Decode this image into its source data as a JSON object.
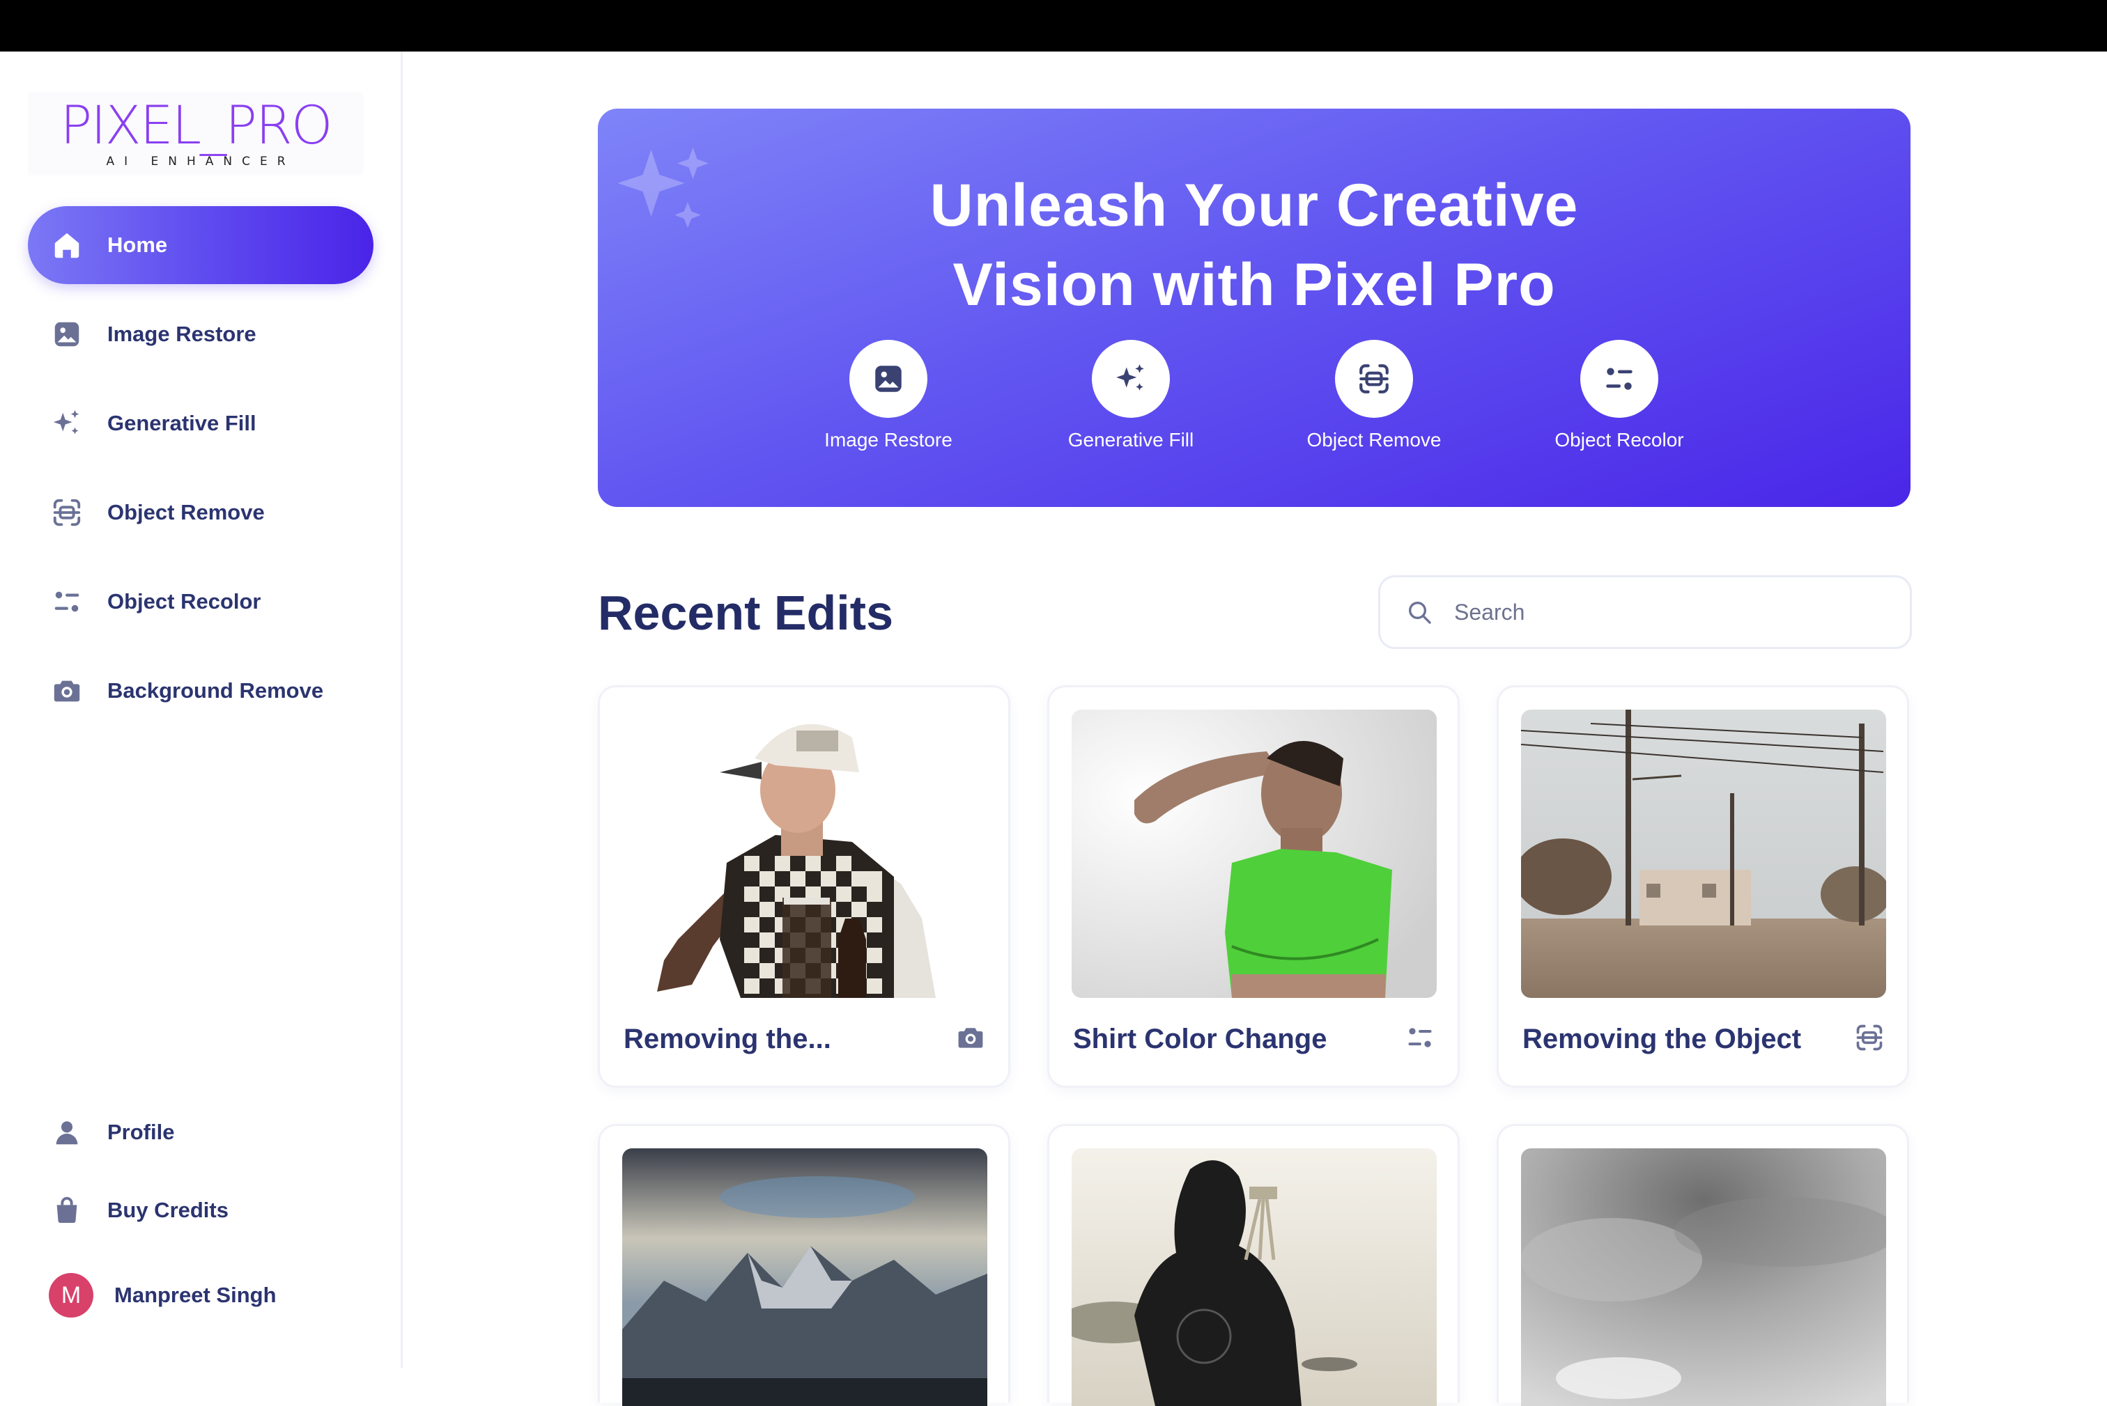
{
  "logo": {
    "main": "PIXEL_PRO",
    "sub": "AI ENHANCER"
  },
  "sidebar": {
    "items": [
      {
        "label": "Home",
        "icon": "home-icon",
        "active": true
      },
      {
        "label": "Image Restore",
        "icon": "image-icon"
      },
      {
        "label": "Generative Fill",
        "icon": "sparkles-icon"
      },
      {
        "label": "Object Remove",
        "icon": "scan-icon"
      },
      {
        "label": "Object Recolor",
        "icon": "recolor-icon"
      },
      {
        "label": "Background Remove",
        "icon": "camera-icon"
      }
    ],
    "bottom": [
      {
        "label": "Profile",
        "icon": "user-icon"
      },
      {
        "label": "Buy Credits",
        "icon": "bag-icon"
      }
    ],
    "user": {
      "initial": "M",
      "name": "Manpreet Singh"
    }
  },
  "hero": {
    "title_line1": "Unleash Your Creative",
    "title_line2": "Vision with Pixel Pro",
    "tools": [
      {
        "label": "Image Restore",
        "icon": "image-icon"
      },
      {
        "label": "Generative Fill",
        "icon": "sparkles-icon"
      },
      {
        "label": "Object Remove",
        "icon": "scan-icon"
      },
      {
        "label": "Object Recolor",
        "icon": "recolor-icon"
      }
    ]
  },
  "recent": {
    "title": "Recent Edits",
    "search_placeholder": "Search",
    "cards": [
      {
        "title": "Removing the...",
        "icon": "camera-icon"
      },
      {
        "title": "Shirt Color Change",
        "icon": "recolor-icon"
      },
      {
        "title": "Removing the Object",
        "icon": "scan-icon"
      },
      {
        "title": "",
        "icon": ""
      },
      {
        "title": "",
        "icon": ""
      },
      {
        "title": "",
        "icon": ""
      }
    ]
  },
  "colors": {
    "accent": "#5b45ee",
    "text": "#2b3470",
    "avatar": "#d8416a",
    "logo": "#8a3ff0"
  }
}
